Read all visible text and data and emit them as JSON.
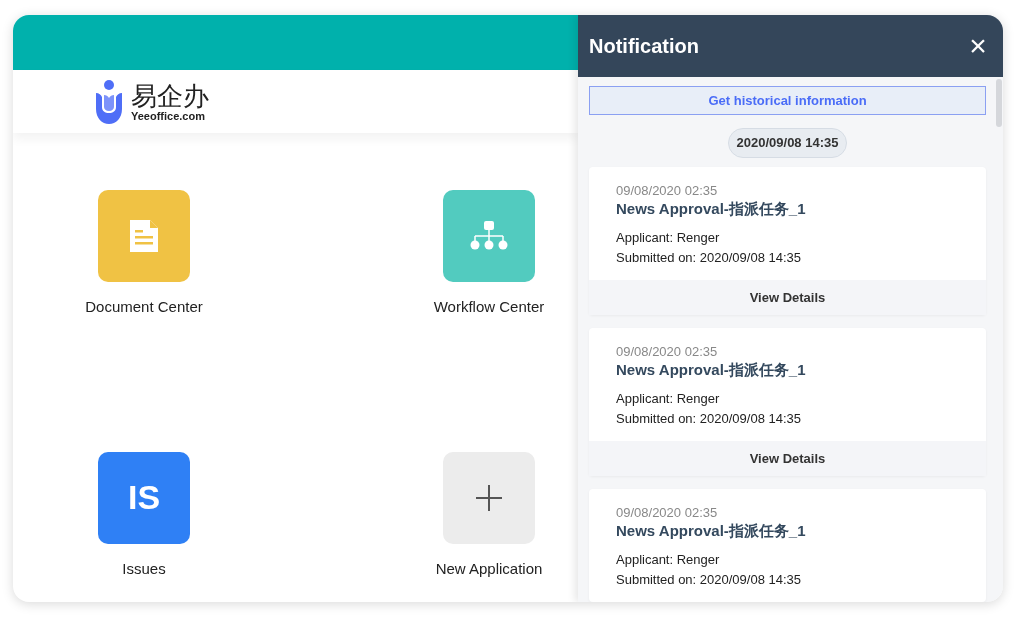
{
  "logo": {
    "name": "易企办",
    "domain": "Yeeoffice.com"
  },
  "apps": [
    {
      "label": "Document Center",
      "kind": "document",
      "color": "#f0c244"
    },
    {
      "label": "Workflow Center",
      "kind": "workflow",
      "color": "#52cbbf"
    },
    {
      "label": "Issues",
      "kind": "text",
      "color": "#2f80f5",
      "initials": "IS"
    },
    {
      "label": "New Application",
      "kind": "add",
      "color": "#ececec"
    }
  ],
  "notification": {
    "title": "Notification",
    "close": "×",
    "history_button": "Get historical information",
    "date_pill": "2020/09/08 14:35",
    "cards": [
      {
        "time": "09/08/2020 02:35",
        "title": "News Approval-指派任务_1",
        "applicant": "Applicant: Renger",
        "submitted": "Submitted on: 2020/09/08 14:35",
        "action": "View Details"
      },
      {
        "time": "09/08/2020 02:35",
        "title": "News Approval-指派任务_1",
        "applicant": "Applicant: Renger",
        "submitted": "Submitted on: 2020/09/08 14:35",
        "action": "View Details"
      },
      {
        "time": "09/08/2020 02:35",
        "title": "News Approval-指派任务_1",
        "applicant": "Applicant: Renger",
        "submitted": "Submitted on: 2020/09/08 14:35"
      }
    ]
  }
}
